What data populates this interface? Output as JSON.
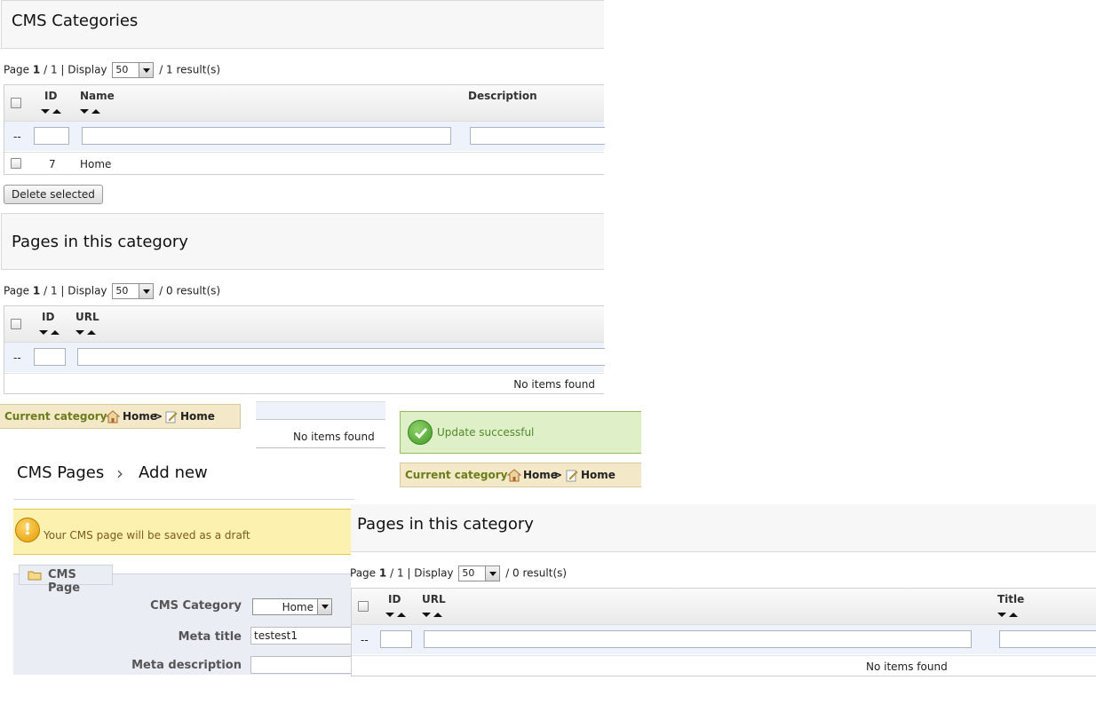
{
  "cms_categories": {
    "title": "CMS Categories",
    "pager": {
      "page_label": "Page",
      "page": "1",
      "sep": "/",
      "total_pages": "1",
      "pipe": "|",
      "display_label": "Display",
      "per_page": "50",
      "results": "/ 1 result(s)"
    },
    "columns": {
      "id": "ID",
      "name": "Name",
      "description": "Description"
    },
    "rows": [
      {
        "id": "7",
        "name": "Home"
      }
    ],
    "filter_dash": "--",
    "delete_button": "Delete selected"
  },
  "pages_top": {
    "title": "Pages in this category",
    "pager": {
      "page_label": "Page",
      "page": "1",
      "sep": "/",
      "total_pages": "1",
      "pipe": "|",
      "display_label": "Display",
      "per_page": "50",
      "results": "/ 0 result(s)"
    },
    "columns": {
      "id": "ID",
      "url": "URL"
    },
    "filter_dash": "--",
    "empty": "No items found"
  },
  "breadcrumb_left": {
    "label": "Current category :",
    "home": "Home",
    "separator": ">",
    "current": "Home"
  },
  "fragment_empty": "No items found",
  "success_message": "Update successful",
  "breadcrumb_right": {
    "label": "Current category :",
    "home": "Home",
    "separator": ">",
    "current": "Home"
  },
  "add_page": {
    "title_part1": "CMS Pages",
    "chevron": "›",
    "title_part2": "Add new",
    "warning": "Your CMS page will be saved as a draft",
    "legend": "CMS Page",
    "fields": {
      "category_label": "CMS Category",
      "category_value": "Home",
      "meta_title_label": "Meta title",
      "meta_title_value": "testest1",
      "meta_desc_label": "Meta description"
    }
  },
  "pages_bottom": {
    "title": "Pages in this category",
    "pager": {
      "page_label": "Page",
      "page": "1",
      "sep": "/",
      "total_pages": "1",
      "pipe": "|",
      "display_label": "Display",
      "per_page": "50",
      "results": "/ 0 result(s)"
    },
    "columns": {
      "id": "ID",
      "url": "URL",
      "title": "Title"
    },
    "filter_dash": "--",
    "empty": "No items found"
  },
  "colors": {
    "success_bg": "#dff0c8",
    "warning_bg": "#fdf1b0",
    "breadcrumb_bg": "#f3e8c8"
  }
}
